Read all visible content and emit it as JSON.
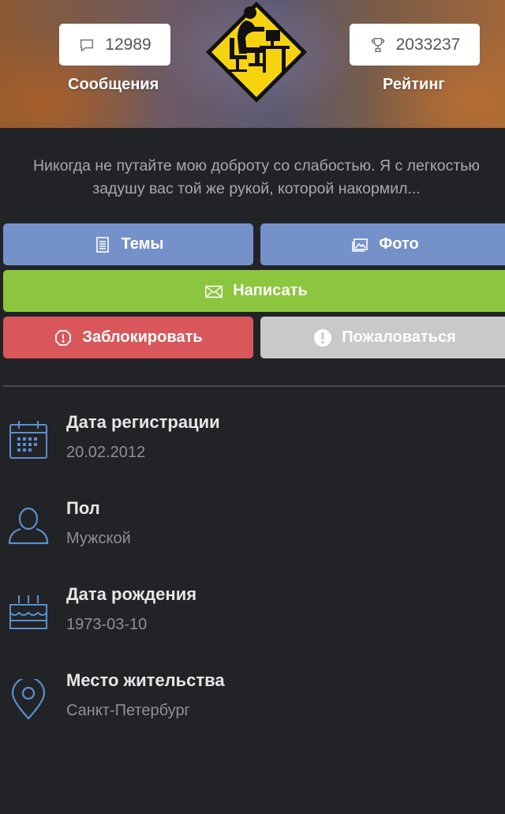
{
  "header": {
    "messages": {
      "count": "12989",
      "label": "Сообщения",
      "icon": "speech-bubble-icon"
    },
    "rating": {
      "count": "2033237",
      "label": "Рейтинг",
      "icon": "trophy-icon"
    },
    "avatar": {
      "icon": "person-at-computer-warning-sign-icon",
      "colors": {
        "sign": "#f5d40f",
        "border": "#111111"
      }
    }
  },
  "quote": {
    "line1": "Никогда не путайте мою доброту со слабостью. Я с легкостью",
    "line2": "задушу вас той же рукой, которой накормил..."
  },
  "actions": {
    "topics": {
      "label": "Темы",
      "icon": "document-icon",
      "color": "#7591c9"
    },
    "photo": {
      "label": "Фото",
      "icon": "image-icon",
      "color": "#7591c9"
    },
    "write": {
      "label": "Написать",
      "icon": "envelope-icon",
      "color": "#8cc63f"
    },
    "block": {
      "label": "Заблокировать",
      "icon": "stop-octagon-icon",
      "color": "#d9575b"
    },
    "report": {
      "label": "Пожаловаться",
      "icon": "exclamation-circle-icon",
      "color": "#c9c9c9"
    }
  },
  "info": [
    {
      "title": "Дата регистрации",
      "value": "20.02.2012",
      "icon": "calendar-icon"
    },
    {
      "title": "Пол",
      "value": "Мужской",
      "icon": "user-icon"
    },
    {
      "title": "Дата рождения",
      "value": "1973-03-10",
      "icon": "birthday-cake-icon"
    },
    {
      "title": "Место жительства",
      "value": "Санкт-Петербург",
      "icon": "location-pin-icon"
    }
  ],
  "theme": {
    "background": "#222326",
    "icon_color": "#5a8fd0"
  }
}
